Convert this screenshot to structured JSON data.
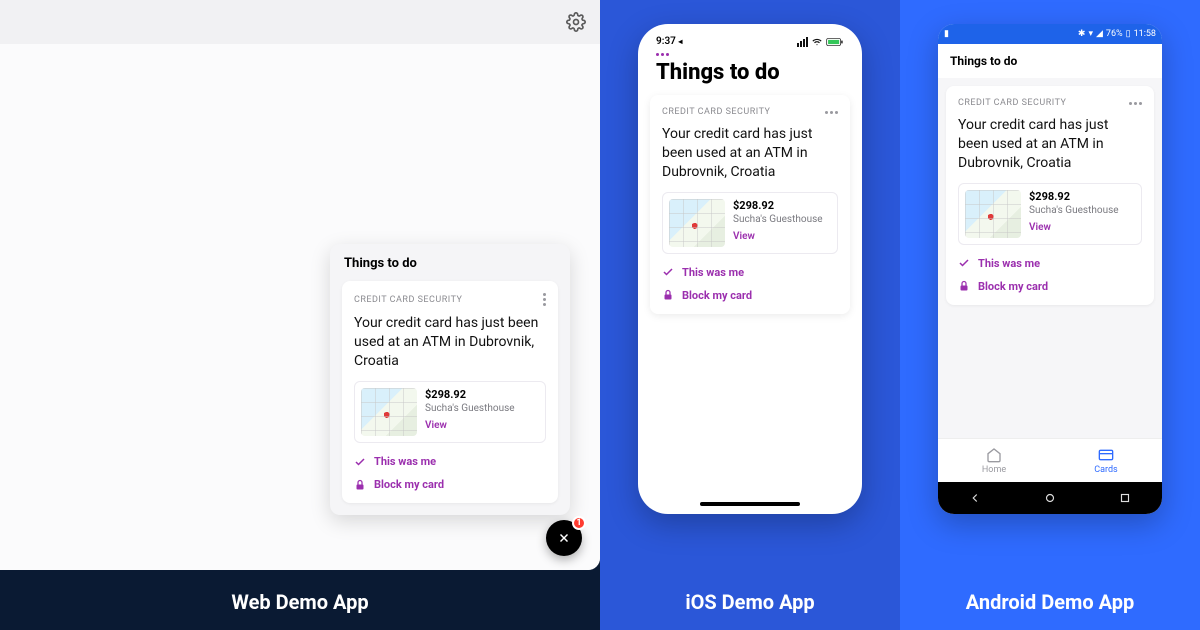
{
  "captions": {
    "web": "Web Demo App",
    "ios": "iOS Demo App",
    "android": "Android Demo App"
  },
  "panel": {
    "title": "Things to do",
    "card": {
      "kicker": "CREDIT CARD SECURITY",
      "headline": "Your credit card has just been used at an ATM in Dubrovnik, Croatia",
      "amount": "$298.92",
      "merchant": "Sucha's Guesthouse",
      "view": "View",
      "action_confirm": "This was me",
      "action_block": "Block my card"
    }
  },
  "fab_badge": "1",
  "ios_status": {
    "time": "9:37"
  },
  "android_status": {
    "battery": "76%",
    "time": "11:58"
  },
  "android_tabs": {
    "home": "Home",
    "cards": "Cards"
  }
}
